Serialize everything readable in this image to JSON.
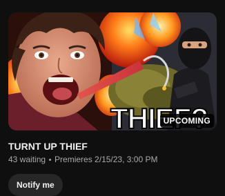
{
  "video": {
    "title": "TURNT UP THIEF",
    "thumbnail_text": "THIEF?",
    "badge": "UPCOMING",
    "waiting": "43 waiting",
    "premiere": "Premieres 2/15/23, 3:00 PM"
  },
  "actions": {
    "notify_label": "Notify me"
  },
  "colors": {
    "background": "#0f0f0f",
    "title_text": "#f1f1f1",
    "meta_text": "#aaaaaa",
    "button_bg": "#272727",
    "badge_bg": "#000000"
  }
}
